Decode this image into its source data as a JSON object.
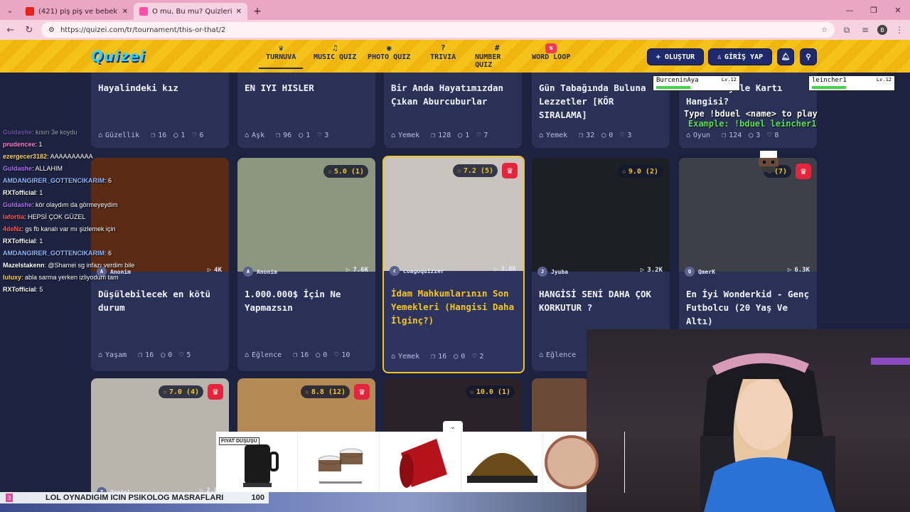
{
  "browser": {
    "tabs": [
      {
        "title": "(421) piş piş ve bebek uyku mü...",
        "color": "#e62117",
        "active": false
      },
      {
        "title": "O mu, Bu mu? Quizleri | Turnu...",
        "color": "#ff4fa8",
        "active": true
      }
    ],
    "url": "https://quizei.com/tr/tournament/this-or-that/2",
    "profile_initial": "B"
  },
  "site": {
    "logo": "Quizei",
    "nav": [
      {
        "label": "TURNUVA",
        "icon": "trophy-icon",
        "glyph": "♛",
        "active": true
      },
      {
        "label": "MUSIC QUIZ",
        "icon": "music-icon",
        "glyph": "♫",
        "active": false
      },
      {
        "label": "PHOTO QUIZ",
        "icon": "camera-icon",
        "glyph": "◉",
        "active": false
      },
      {
        "label": "TRIVIA",
        "icon": "speech-icon",
        "glyph": "?",
        "active": false
      },
      {
        "label": "NUMBER QUIZ",
        "icon": "hash-icon",
        "glyph": "#",
        "active": false
      },
      {
        "label": "WORD LOOP",
        "icon": "word-loop-icon",
        "glyph": "⇅",
        "active": false
      }
    ],
    "create_label": "+ OLUŞTUR",
    "login_label": "GİRİŞ YAP"
  },
  "cards_row1": [
    {
      "title": "Hayalindeki kız",
      "category": "Güzellik",
      "questions": "16",
      "comments": "1",
      "likes": "6"
    },
    {
      "title": "EN IYI HISLER",
      "category": "Aşk",
      "questions": "96",
      "comments": "1",
      "likes": "3"
    },
    {
      "title": "Bir Anda Hayatımızdan Çıkan Aburcuburlar",
      "category": "Yemek",
      "questions": "128",
      "comments": "1",
      "likes": "7"
    },
    {
      "title": "Gün Tabağında Buluna Lezzetler [KÖR SIRALAMA]",
      "category": "Yemek",
      "questions": "32",
      "comments": "0",
      "likes": "3"
    },
    {
      "title": "Clash Royale Kartı Hangisi?",
      "category": "Oyun",
      "questions": "124",
      "comments": "3",
      "likes": "8"
    }
  ],
  "cards_row2": [
    {
      "title": "Düşülebilecek en kötü durum",
      "author": "Anonim",
      "plays": "4K",
      "rating": "",
      "category": "Yaşam",
      "questions": "16",
      "comments": "0",
      "likes": "5",
      "img": "#5a2a12",
      "crown": false
    },
    {
      "title": "1.000.000$ İçin Ne Yapmazsın",
      "author": "Anonim",
      "plays": "7.6K",
      "rating": "5.0 (1)",
      "category": "Eğlence",
      "questions": "16",
      "comments": "0",
      "likes": "10",
      "img": "#8d9780",
      "crown": false
    },
    {
      "title": "İdam Mahkumlarının Son Yemekleri (Hangisi Daha İlginç?)",
      "author": "coagoquizzer",
      "plays": "3.8K",
      "rating": "7.2 (5)",
      "category": "Yemek",
      "questions": "16",
      "comments": "0",
      "likes": "2",
      "img": "#c9c4be",
      "crown": true
    },
    {
      "title": "HANGİSİ SENİ DAHA ÇOK KORKUTUR ?",
      "author": "Jyuba",
      "plays": "3.2K",
      "rating": "9.0 (2)",
      "category": "Eğlence",
      "questions": "",
      "comments": "",
      "likes": "",
      "img": "#1d1f24",
      "crown": false
    },
    {
      "title": "En İyi Wonderkid - Genç Futbolcu (20 Yaş Ve Altı)",
      "author": "QmerK",
      "plays": "6.3K",
      "rating": "(7)",
      "category": "",
      "questions": "",
      "comments": "",
      "likes": "",
      "img": "#3d4048",
      "crown": true
    }
  ],
  "cards_row3": [
    {
      "author": "Zeniol",
      "plays": "2.8K",
      "rating": "7.0 (4)",
      "img": "#b9b5ad",
      "crown": true
    },
    {
      "author": "",
      "plays": "",
      "rating": "8.8 (12)",
      "img": "#b68a55",
      "crown": true
    },
    {
      "author": "",
      "plays": "",
      "rating": "10.0 (1)",
      "img": "#2a2226",
      "crown": false
    },
    {
      "author": "",
      "plays": "",
      "rating": "",
      "img": "#6b4a3a",
      "crown": false
    }
  ],
  "chat": [
    {
      "user": "Guldashe",
      "msg": ": kısırı 3e koydu",
      "color": "#b06bff",
      "dim": true
    },
    {
      "user": "prudencee",
      "msg": ": 1",
      "color": "#ff7ad9",
      "dim": false
    },
    {
      "user": "ezergecer3182",
      "msg": ": AAAAAAAAAA",
      "color": "#ffd24a",
      "dim": false
    },
    {
      "user": "Guldashe",
      "msg": ": ALLAHIM",
      "color": "#b06bff",
      "dim": false
    },
    {
      "user": "AMDANGIRER_GOTTENCIKARIM",
      "msg": ": 6",
      "color": "#8fb8ff",
      "dim": false
    },
    {
      "user": "RXTofficial",
      "msg": ": 1",
      "color": "#ffffff",
      "dim": false
    },
    {
      "user": "Guldashe",
      "msg": ": kör olaydım da görmeyeydim",
      "color": "#b06bff",
      "dim": false
    },
    {
      "user": "lafortia",
      "msg": ": HEPSİ ÇOK GÜZEL",
      "color": "#ff5a5a",
      "dim": false
    },
    {
      "user": "4deNz",
      "msg": ": gs fb kanalı var mı şizlemek için",
      "color": "#ff5a5a",
      "dim": false
    },
    {
      "user": "RXTofficial",
      "msg": ": 1",
      "color": "#ffffff",
      "dim": false
    },
    {
      "user": "AMDANGIRER_GOTTENCIKARIM",
      "msg": ": 6",
      "color": "#8fb8ff",
      "dim": false
    },
    {
      "user": "Mazelstakenn",
      "msg": ": @Shamei sg infazı verdim bile",
      "color": "#ffffff",
      "dim": false
    },
    {
      "user": "luluxy",
      "msg": ": abla sarma yerken izliyodum tam",
      "color": "#ffd24a",
      "dim": false
    },
    {
      "user": "RXTofficial",
      "msg": ": 5",
      "color": "#ffffff",
      "dim": false
    }
  ],
  "game_overlay": {
    "player1": {
      "name": "BurceninAya",
      "level": "Lv.12"
    },
    "player2": {
      "name": "leincher1",
      "level": "Lv.12"
    },
    "hp_label": "HP:",
    "instruction": "Type !bduel <name> to play",
    "example": "Example: !bduel leincher1"
  },
  "ads": {
    "badge": "FIYAT DÜŞÜŞÜ",
    "items": [
      "black-kettle",
      "espresso-cups",
      "red-capsule",
      "gold-capsule",
      "coffee-tin"
    ]
  },
  "bottom_bar": {
    "number": "3",
    "text": "LOL OYNADIGIM ICIN PSIKOLOG MASRAFLARI",
    "value": "100"
  },
  "colors": {
    "accent_yellow": "#f3c522",
    "header_blue": "#1e2a6b",
    "card_bg": "#2a3157",
    "crown_red": "#e4253c"
  }
}
